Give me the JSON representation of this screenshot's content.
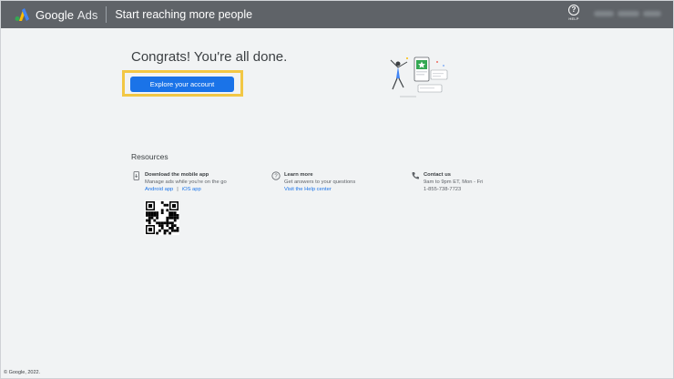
{
  "header": {
    "brand_google": "Google",
    "brand_ads": "Ads",
    "title": "Start reaching more people",
    "help_label": "HELP"
  },
  "main": {
    "headline": "Congrats! You're all done.",
    "primary_button": "Explore your account",
    "highlight_color": "#f2c744",
    "accent_color": "#1a73e8"
  },
  "resources": {
    "title": "Resources",
    "mobile": {
      "title": "Download the mobile app",
      "desc": "Manage ads while you're on the go",
      "android": "Android app",
      "separator": "|",
      "ios": "iOS app"
    },
    "learn": {
      "title": "Learn more",
      "desc": "Get answers to your questions",
      "link": "Visit the Help center"
    },
    "contact": {
      "title": "Contact us",
      "hours": "9am to 9pm ET, Mon - Fri",
      "phone": "1-855-738-7723"
    }
  },
  "footer": {
    "copyright": "© Google, 2022."
  }
}
